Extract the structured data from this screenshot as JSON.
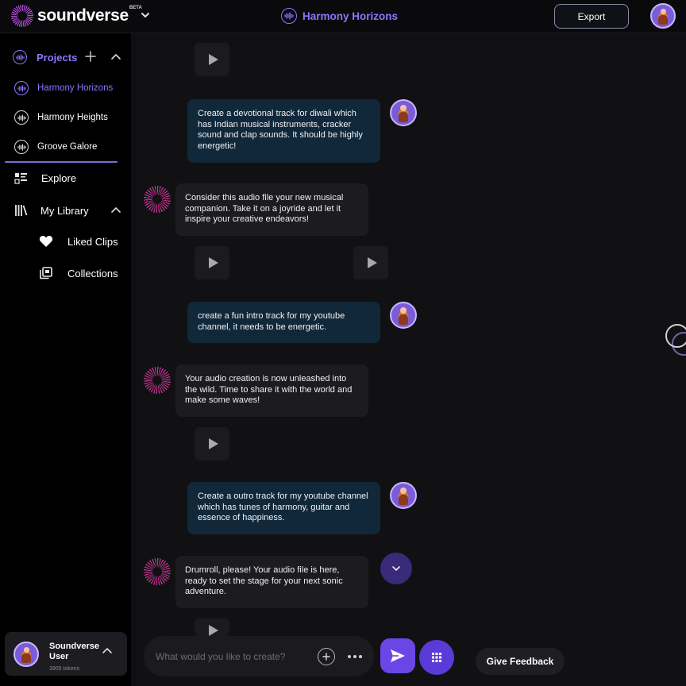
{
  "header": {
    "logo_text": "soundverse",
    "logo_badge": "BETA",
    "project_title": "Harmony Horizons",
    "export_label": "Export"
  },
  "sidebar": {
    "projects_label": "Projects",
    "projects": [
      {
        "label": "Harmony Horizons",
        "active": true
      },
      {
        "label": "Harmony Heights",
        "active": false
      },
      {
        "label": "Groove Galore",
        "active": false
      }
    ],
    "explore_label": "Explore",
    "library_label": "My Library",
    "library_items": [
      {
        "label": "Liked Clips",
        "icon": "heart-icon"
      },
      {
        "label": "Collections",
        "icon": "collections-icon"
      }
    ],
    "user": {
      "name": "Soundverse User",
      "tokens": "3905 tokens"
    }
  },
  "chat": {
    "messages": [
      {
        "role": "user",
        "text": "Create a devotional track for diwali which has Indian musical instruments, cracker sound and clap sounds. It should be highly energetic!"
      },
      {
        "role": "assistant",
        "text": "Consider this audio file your new musical companion. Take it on a joyride and let it inspire your creative endeavors!"
      },
      {
        "role": "user",
        "text": "create a fun intro track for my youtube channel, it needs to be energetic."
      },
      {
        "role": "assistant",
        "text": "Your audio creation is now unleashed into the wild. Time to share it with the world and make some waves!"
      },
      {
        "role": "user",
        "text": "Create a outro track for my youtube channel which has tunes of harmony, guitar and essence of happiness."
      },
      {
        "role": "assistant",
        "text": "Drumroll, please! Your audio file is here, ready to set the stage for your next sonic adventure."
      }
    ]
  },
  "composer": {
    "placeholder": "What would you like to create?",
    "value": ""
  },
  "feedback_label": "Give Feedback",
  "colors": {
    "accent": "#8f74ff",
    "user_bubble": "#10283a",
    "bot_bubble": "#1b1b20",
    "send_button": "#6b46e6"
  }
}
